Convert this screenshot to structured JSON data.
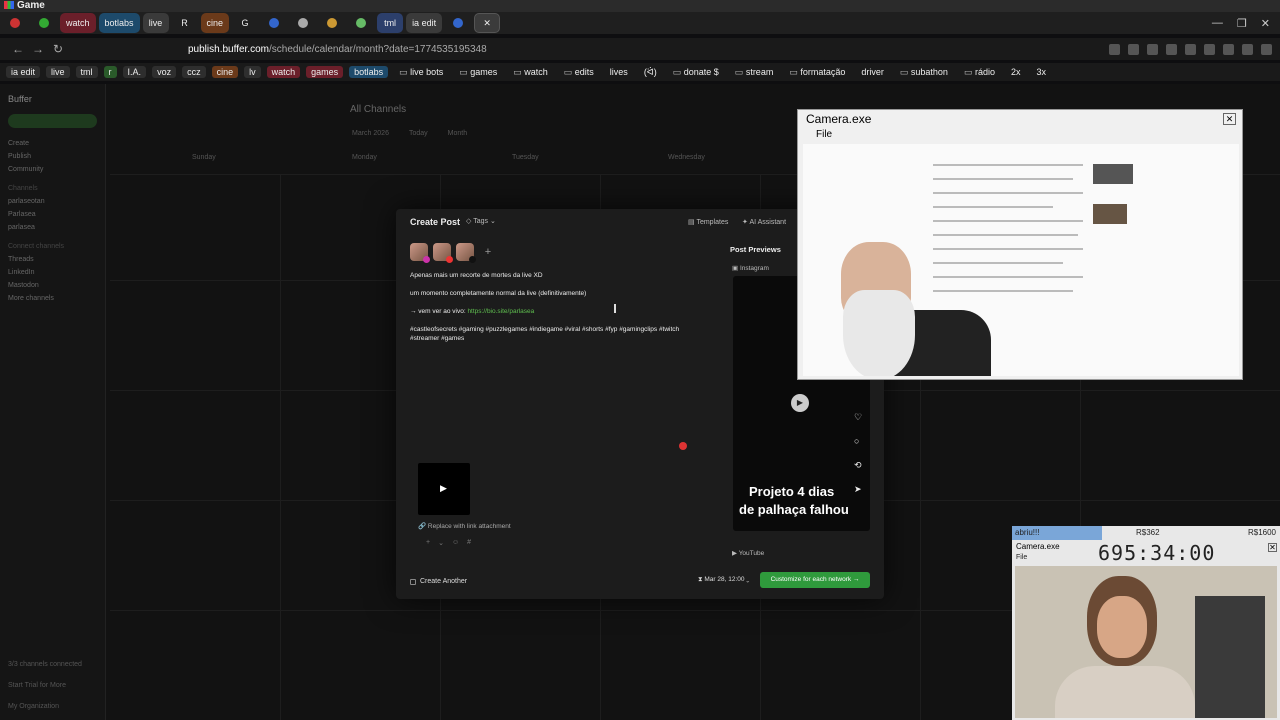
{
  "window": {
    "title": "Game"
  },
  "tabs": [
    {
      "label": "",
      "style": ""
    },
    {
      "label": "",
      "style": ""
    },
    {
      "label": "watch",
      "style": "watch"
    },
    {
      "label": "botlabs",
      "style": "botlabs"
    },
    {
      "label": "live",
      "style": "named"
    },
    {
      "label": "R",
      "style": ""
    },
    {
      "label": "cine",
      "style": "cine"
    },
    {
      "label": "G",
      "style": ""
    },
    {
      "label": "",
      "style": ""
    },
    {
      "label": "",
      "style": ""
    },
    {
      "label": "",
      "style": ""
    },
    {
      "label": "",
      "style": ""
    },
    {
      "label": "tml",
      "style": "tml"
    },
    {
      "label": "ia edit",
      "style": "named"
    },
    {
      "label": "",
      "style": ""
    },
    {
      "label": "✕",
      "style": "active"
    }
  ],
  "address": {
    "domain": "publish.buffer.com",
    "path": "/schedule/calendar/month?date=1774535195348"
  },
  "bookmarks": [
    {
      "label": "ia edit",
      "style": "chip"
    },
    {
      "label": "live",
      "style": "chip"
    },
    {
      "label": "tml",
      "style": "chip"
    },
    {
      "label": "r",
      "style": "r"
    },
    {
      "label": "I.A.",
      "style": "chip"
    },
    {
      "label": "voz",
      "style": "chip"
    },
    {
      "label": "ccz",
      "style": "chip"
    },
    {
      "label": "cine",
      "style": "cine"
    },
    {
      "label": "lv",
      "style": "chip"
    },
    {
      "label": "watch",
      "style": "watch"
    },
    {
      "label": "games",
      "style": "games"
    },
    {
      "label": "botlabs",
      "style": "botlabs"
    },
    {
      "label": "live bots",
      "style": "folder"
    },
    {
      "label": "games",
      "style": "folder"
    },
    {
      "label": "watch",
      "style": "folder"
    },
    {
      "label": "edits",
      "style": "folder"
    },
    {
      "label": "lives",
      "style": ""
    },
    {
      "label": "(ᐛ)",
      "style": ""
    },
    {
      "label": "donate $",
      "style": "folder"
    },
    {
      "label": "stream",
      "style": "folder"
    },
    {
      "label": "formatação",
      "style": "folder"
    },
    {
      "label": "driver",
      "style": ""
    },
    {
      "label": "subathon",
      "style": "folder"
    },
    {
      "label": "rádio",
      "style": "folder"
    },
    {
      "label": "2x",
      "style": ""
    },
    {
      "label": "3x",
      "style": ""
    }
  ],
  "sidebar": {
    "brand": "Buffer",
    "items": [
      "Create",
      "Publish",
      "Community"
    ],
    "section_channels": "Channels",
    "channels": [
      "parlaseotan",
      "Parlasea",
      "parlasea"
    ],
    "section_connect": "Connect channels",
    "connect": [
      "Threads",
      "LinkedIn",
      "Mastodon",
      "More channels"
    ],
    "bottom_status": "3/3 channels connected",
    "trial": "Start Trial for More",
    "org": "My Organization"
  },
  "calendar": {
    "title": "All Channels",
    "month": "March 2026",
    "today": "Today",
    "view": "Month",
    "days": [
      "Sunday",
      "Monday",
      "Tuesday",
      "Wednesday"
    ]
  },
  "modal": {
    "title": "Create Post",
    "tags": "Tags",
    "templates": "Templates",
    "ai": "AI Assistant",
    "editor": {
      "line1": "Apenas mais um recorte de mortes da live XD",
      "line2": "um momento completamente normal da live (definitivamente)",
      "line3_prefix": "→ vem ver ao vivo: ",
      "line3_link": "https://bio.site/parlasea",
      "hashtags": "#castleofsecrets #gaming #puzzlegames #indiegame #viral #shorts #fyp #gamingclips #twitch #streamer #games"
    },
    "replace": "Replace with link attachment",
    "create_another": "Create Another",
    "schedule": "Mar 28, 12:00",
    "customize": "Customize for each network",
    "previews": {
      "title": "Post Previews",
      "instagram": "Instagram",
      "caption1": "Projeto 4 dias",
      "caption2": "de palhaça falhou",
      "youtube": "YouTube"
    }
  },
  "camera_window": {
    "title": "Camera.exe",
    "menu": "File"
  },
  "small_camera": {
    "label1": "abriu!!!",
    "label2": "R$362",
    "label3": "R$1600",
    "title": "Camera.exe",
    "file": "File",
    "timer": "695:34:00"
  }
}
